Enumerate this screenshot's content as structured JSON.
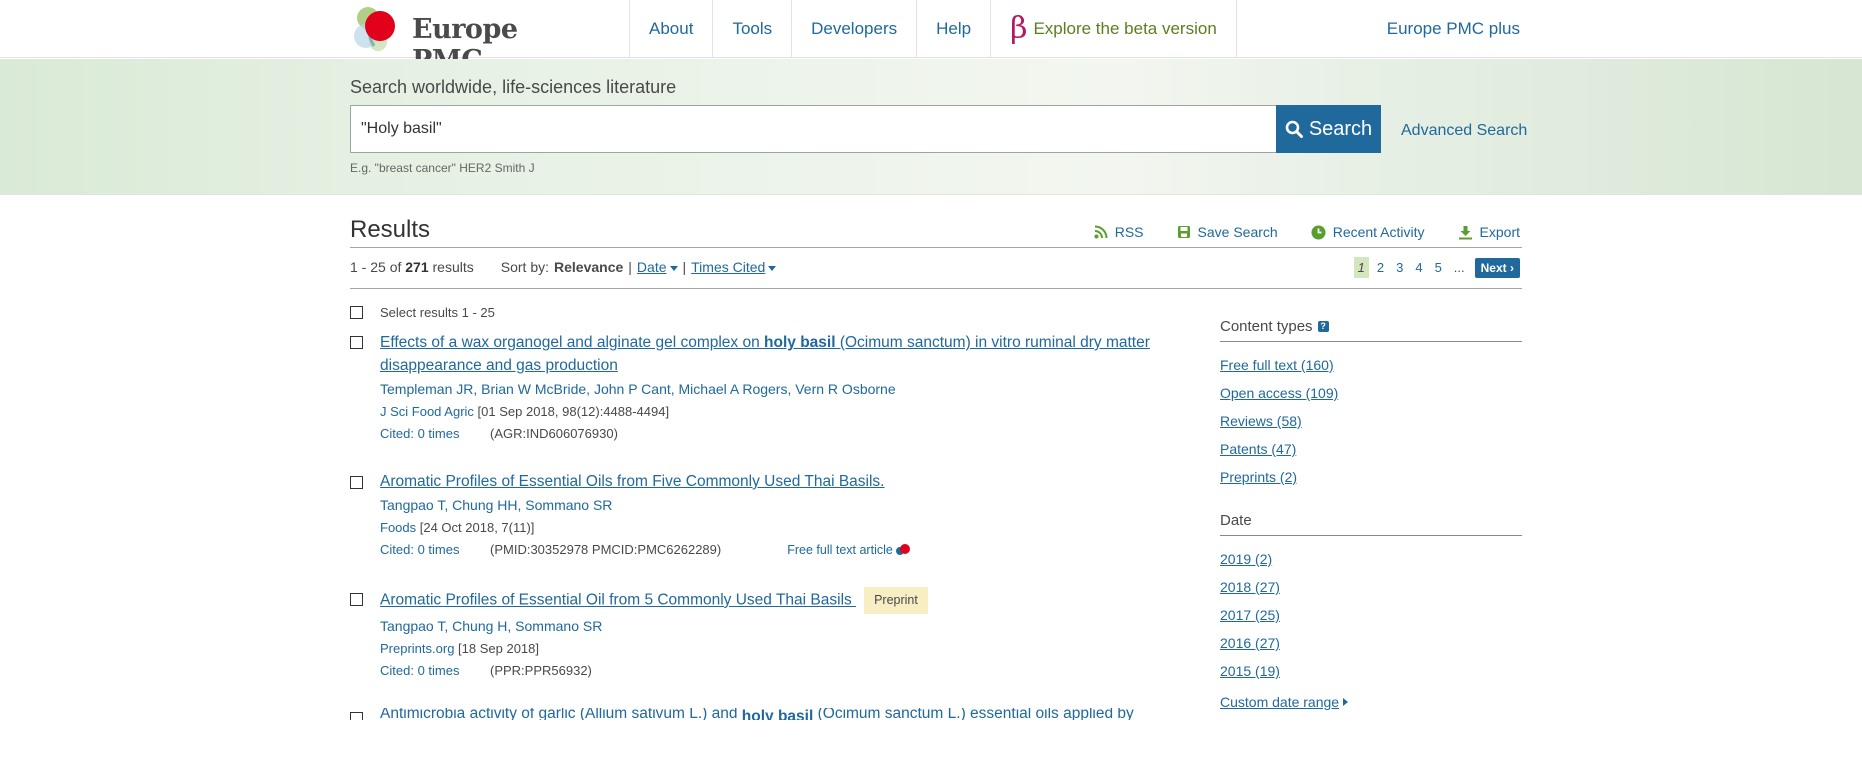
{
  "header": {
    "logo_text": "Europe PMC",
    "nav": [
      "About",
      "Tools",
      "Developers",
      "Help"
    ],
    "beta_symbol": "β",
    "beta_label": "Explore the beta version",
    "plus_link": "Europe PMC plus"
  },
  "search": {
    "title": "Search worldwide, life-sciences literature",
    "value": "\"Holy basil\"",
    "button_label": "Search",
    "advanced_label": "Advanced Search",
    "example": "E.g. \"breast cancer\" HER2 Smith J"
  },
  "results": {
    "heading": "Results",
    "actions": {
      "rss": "RSS",
      "save": "Save Search",
      "recent": "Recent Activity",
      "export": "Export"
    },
    "range_text": "1 - 25 of",
    "total": "271",
    "results_word": "results",
    "sort_label": "Sort by:",
    "sort_selected": "Relevance",
    "sort_sep": "|",
    "sort_date": "Date",
    "sort_cited": "Times Cited",
    "pagination": {
      "pages": [
        "1",
        "2",
        "3",
        "4",
        "5"
      ],
      "ellipsis": "...",
      "next": "Next"
    },
    "select_label": "Select results 1 - 25",
    "items": [
      {
        "title_pre": "Effects of a wax organogel and alginate gel complex on ",
        "title_bold": "holy basil",
        "title_post": " (Ocimum sanctum) in vitro ruminal dry matter disappearance and gas production",
        "authors": "Templeman JR, Brian W McBride, John P Cant, Michael A Rogers, Vern R Osborne",
        "journal": "J Sci Food Agric",
        "journal_info": " [01 Sep 2018, 98(12):4488-4494]",
        "cited": "Cited: 0 times",
        "ids": "(AGR:IND606076930)"
      },
      {
        "title": "Aromatic Profiles of Essential Oils from Five Commonly Used Thai Basils.",
        "authors": "Tangpao T, Chung HH, Sommano SR",
        "journal": "Foods",
        "journal_info": " [24 Oct 2018, 7(11)]",
        "cited": "Cited: 0 times",
        "ids": "(PMID:30352978 PMCID:PMC6262289)",
        "fulltext": "Free full text article"
      },
      {
        "title": "Aromatic Profiles of Essential Oil from 5 Commonly Used Thai Basils ",
        "badge": "Preprint",
        "authors": "Tangpao T, Chung H, Sommano SR",
        "journal": "Preprints.org",
        "journal_info": " [18 Sep 2018]",
        "cited": "Cited: 0 times",
        "ids": "(PPR:PPR56932)"
      }
    ],
    "cut_item": {
      "pre": "Antimicrobia activity of garlic (Allium sativum L.) and ",
      "bold": "holy basil",
      "post": " (Ocimum sanctum L.) essential oils applied by"
    }
  },
  "sidebar": {
    "content_types_title": "Content types",
    "help_icon": "?",
    "content_types": [
      "Free full text (160)",
      "Open access (109)",
      "Reviews (58)",
      "Patents (47)",
      "Preprints (2)"
    ],
    "date_title": "Date",
    "dates": [
      "2019 (2)",
      "2018 (27)",
      "2017 (25)",
      "2016 (27)",
      "2015 (19)"
    ],
    "custom_range": "Custom date range"
  },
  "colors": {
    "link": "#20699c",
    "search_button": "#20699c",
    "beta": "#b2195f",
    "beta_text": "#5b7f1f",
    "current_page_bg": "#d3e6bd",
    "preprint_badge_bg": "#f8eec4"
  }
}
